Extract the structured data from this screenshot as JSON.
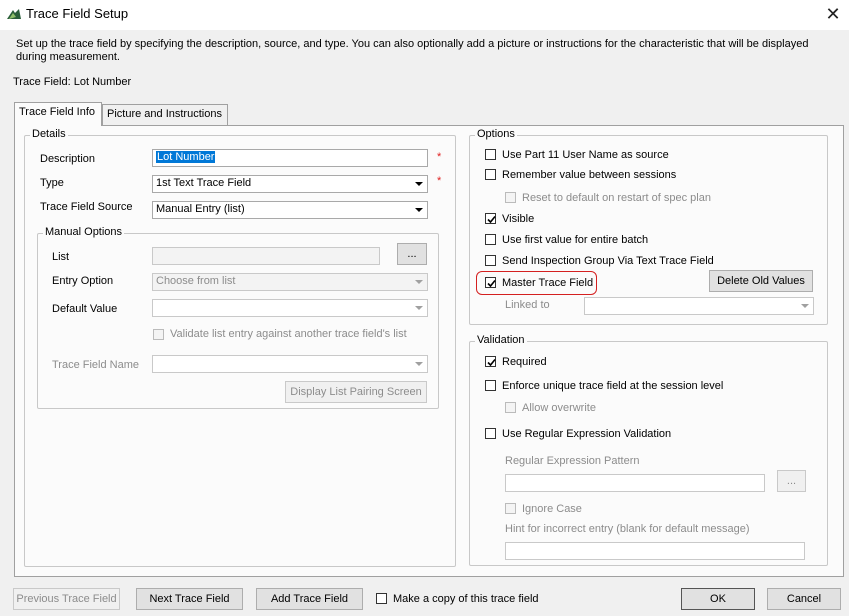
{
  "window": {
    "title": "Trace Field Setup",
    "close_glyph": "✕"
  },
  "description_text": "Set up the trace field by specifying the description, source, and type. You can also optionally add a picture or instructions for the characteristic that will be displayed during measurement.",
  "trace_field_label": "Trace Field: Lot Number",
  "tabs": [
    {
      "label": "Trace Field Info",
      "active": true
    },
    {
      "label": "Picture and Instructions",
      "active": false
    }
  ],
  "details": {
    "group_title": "Details",
    "description_label": "Description",
    "description_value": "Lot Number",
    "type_label": "Type",
    "type_value": "1st Text Trace Field",
    "source_label": "Trace Field Source",
    "source_value": "Manual Entry (list)",
    "required_marker": "*"
  },
  "manual_options": {
    "group_title": "Manual Options",
    "list_label": "List",
    "list_button": "...",
    "entry_option_label": "Entry Option",
    "entry_option_value": "Choose from list",
    "default_value_label": "Default Value",
    "validate_label": "Validate list entry against another trace field's list",
    "trace_field_name_label": "Trace Field Name",
    "display_pairing_button": "Display List Pairing Screen"
  },
  "options": {
    "group_title": "Options",
    "items": [
      {
        "label": "Use Part 11 User Name as source",
        "checked": false,
        "disabled": false
      },
      {
        "label": "Remember value between sessions",
        "checked": false,
        "disabled": false
      },
      {
        "label": "Reset to default on restart of spec plan",
        "checked": false,
        "disabled": true
      },
      {
        "label": "Visible",
        "checked": true,
        "disabled": false
      },
      {
        "label": "Use first value for entire batch",
        "checked": false,
        "disabled": false
      },
      {
        "label": "Send Inspection Group Via Text Trace Field",
        "checked": false,
        "disabled": false
      },
      {
        "label": "Master Trace Field",
        "checked": true,
        "disabled": false
      }
    ],
    "delete_old_values_button": "Delete Old Values",
    "linked_to_label": "Linked to"
  },
  "validation": {
    "group_title": "Validation",
    "required_label": "Required",
    "required_checked": true,
    "enforce_unique_label": "Enforce unique trace field at the session level",
    "allow_overwrite_label": "Allow overwrite",
    "regex_label": "Use Regular Expression Validation",
    "regex_pattern_label": "Regular Expression Pattern",
    "regex_button": "...",
    "ignore_case_label": "Ignore Case",
    "hint_label": "Hint for incorrect entry (blank for default message)"
  },
  "footer": {
    "previous_button": "Previous Trace Field",
    "next_button": "Next Trace Field",
    "add_button": "Add Trace Field",
    "copy_label": "Make a copy of this trace field",
    "ok_button": "OK",
    "cancel_button": "Cancel"
  },
  "colors": {
    "selection": "#0078d7",
    "required": "#e02020",
    "highlight": "#d42020"
  }
}
